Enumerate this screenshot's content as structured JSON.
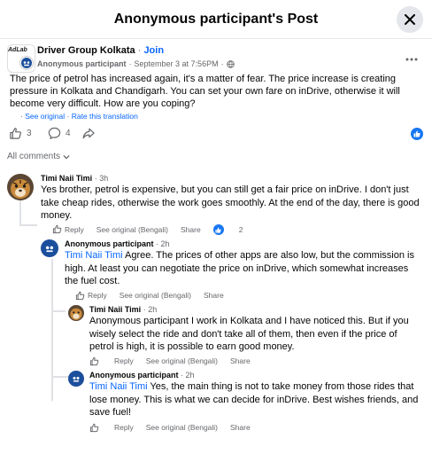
{
  "header": {
    "title": "Anonymous participant's Post"
  },
  "post": {
    "logo_text": "AdLab",
    "group_name": "Driver Group Kolkata",
    "join_label": "Join",
    "author": "Anonymous participant",
    "date": "September 3 at 7:56PM",
    "separator": "·",
    "text": "The price of petrol has increased again, it's a matter of fear. The price increase is creating pressure in Kolkata and Chandigarh. You can set your own fare on inDrive, otherwise it will become very difficult. How are you coping?",
    "see_original": "See original",
    "rate_translation": "Rate this translation",
    "likes": "3",
    "comments": "4"
  },
  "all_comments_label": "All comments",
  "comments": [
    {
      "name": "Timi Naii Timi",
      "time": "3h",
      "text": "Yes brother, petrol is expensive, but you can still get a fair price on inDrive. I don't just take cheap rides, otherwise the work goes smoothly. At the end of the day, there is good money.",
      "reply": "Reply",
      "see_original": "See original (Bengali)",
      "share": "Share",
      "reactions": "2"
    },
    {
      "name": "Anonymous participant",
      "time": "2h",
      "mention": "Timi Naii Timi",
      "text": " Agree. The prices of other apps are also low, but the commission is high. At least you can negotiate the price on inDrive, which somewhat increases the fuel cost.",
      "reply": "Reply",
      "see_original": "See original (Bengali)",
      "share": "Share"
    },
    {
      "name": "Timi Naii Timi",
      "time": "2h",
      "text": "Anonymous participant I work in Kolkata and I have noticed this. But if you wisely select the ride and don't take all of them, then even if the price of petrol is high, it is possible to earn good money.",
      "reply": "Reply",
      "see_original": "See original (Bengali)",
      "share": "Share"
    },
    {
      "name": "Anonymous participant",
      "time": "2h",
      "mention": "Timi Naii Timi",
      "text": " Yes, the main thing is not to take money from those rides that lose money. This is what we can decide for inDrive. Best wishes friends, and save fuel!",
      "reply": "Reply",
      "see_original": "See original (Bengali)",
      "share": "Share"
    }
  ],
  "colors": {
    "accent": "#0866ff",
    "muted": "#65676b",
    "anon_avatar": "#1b4f9c"
  }
}
